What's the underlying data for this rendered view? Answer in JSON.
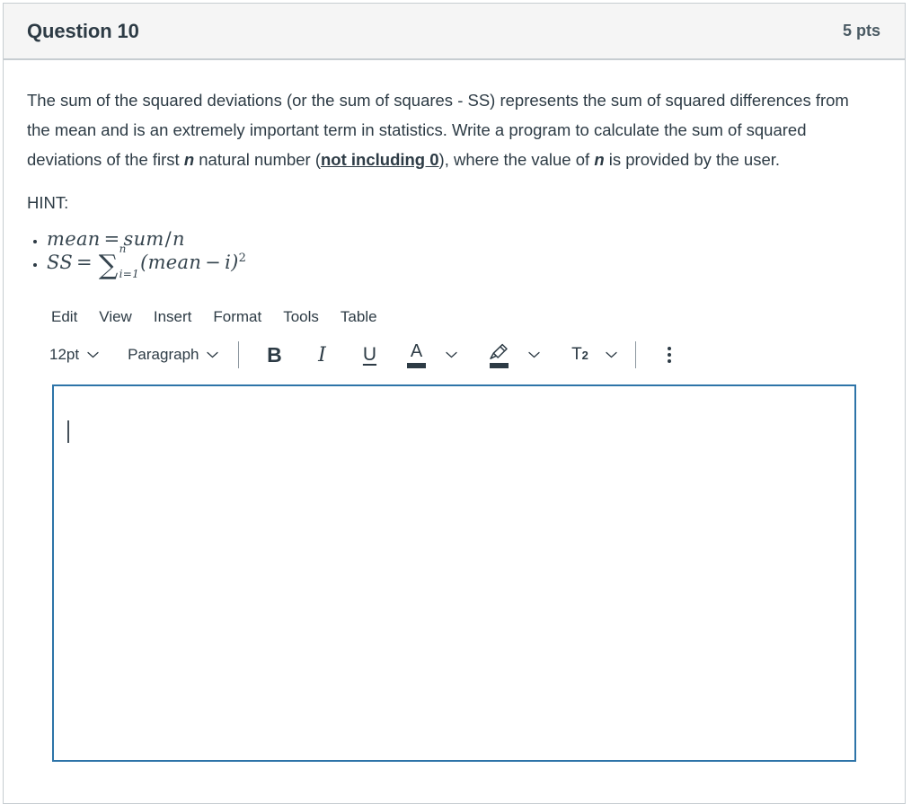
{
  "question": {
    "title": "Question 10",
    "points": "5 pts",
    "prompt": {
      "part1": "The sum of the squared deviations (or the sum of squares - SS) represents the sum of squared differences from the mean and is an extremely important term in statistics. Write a program to calculate the sum of squared deviations of the first ",
      "emphasis_n_1": "n",
      "part2": " natural number (",
      "underlined_bold": "not including 0",
      "part3": "), where the value of ",
      "emphasis_n_2": "n",
      "part4": " is provided by the user."
    },
    "hint_label": "HINT:",
    "formulas": [
      {
        "id": "mean-formula",
        "plain": "mean = sum/n",
        "lhs": "mean",
        "equals": "=",
        "numerator": "sum",
        "slash": "/",
        "denominator": "n"
      },
      {
        "id": "ss-formula",
        "plain": "SS = ∑_{i=1}^{n} (mean − i)²",
        "lhs": "SS",
        "equals": "=",
        "sum_symbol": "∑",
        "upper_limit": "n",
        "lower_limit": "i=1",
        "open_paren": "(",
        "term1": "mean",
        "minus": "−",
        "term2": "i",
        "close_paren": ")",
        "exponent": "2"
      }
    ]
  },
  "editor": {
    "menubar": [
      {
        "label": "Edit",
        "name": "menu-edit"
      },
      {
        "label": "View",
        "name": "menu-view"
      },
      {
        "label": "Insert",
        "name": "menu-insert"
      },
      {
        "label": "Format",
        "name": "menu-format"
      },
      {
        "label": "Tools",
        "name": "menu-tools"
      },
      {
        "label": "Table",
        "name": "menu-table"
      }
    ],
    "toolbar": {
      "font_size": "12pt",
      "block_format": "Paragraph",
      "bold_label": "B",
      "italic_label": "I",
      "underline_label": "U",
      "text_color_label": "A",
      "superscript_label": "T",
      "superscript_exponent": "2"
    },
    "content": "",
    "placeholder": ""
  },
  "colors": {
    "header_bg": "#F5F5F5",
    "card_border": "#C7CDD1",
    "text": "#2D3B45",
    "focus_border": "#2D74A8",
    "divider": "#8B969E"
  }
}
